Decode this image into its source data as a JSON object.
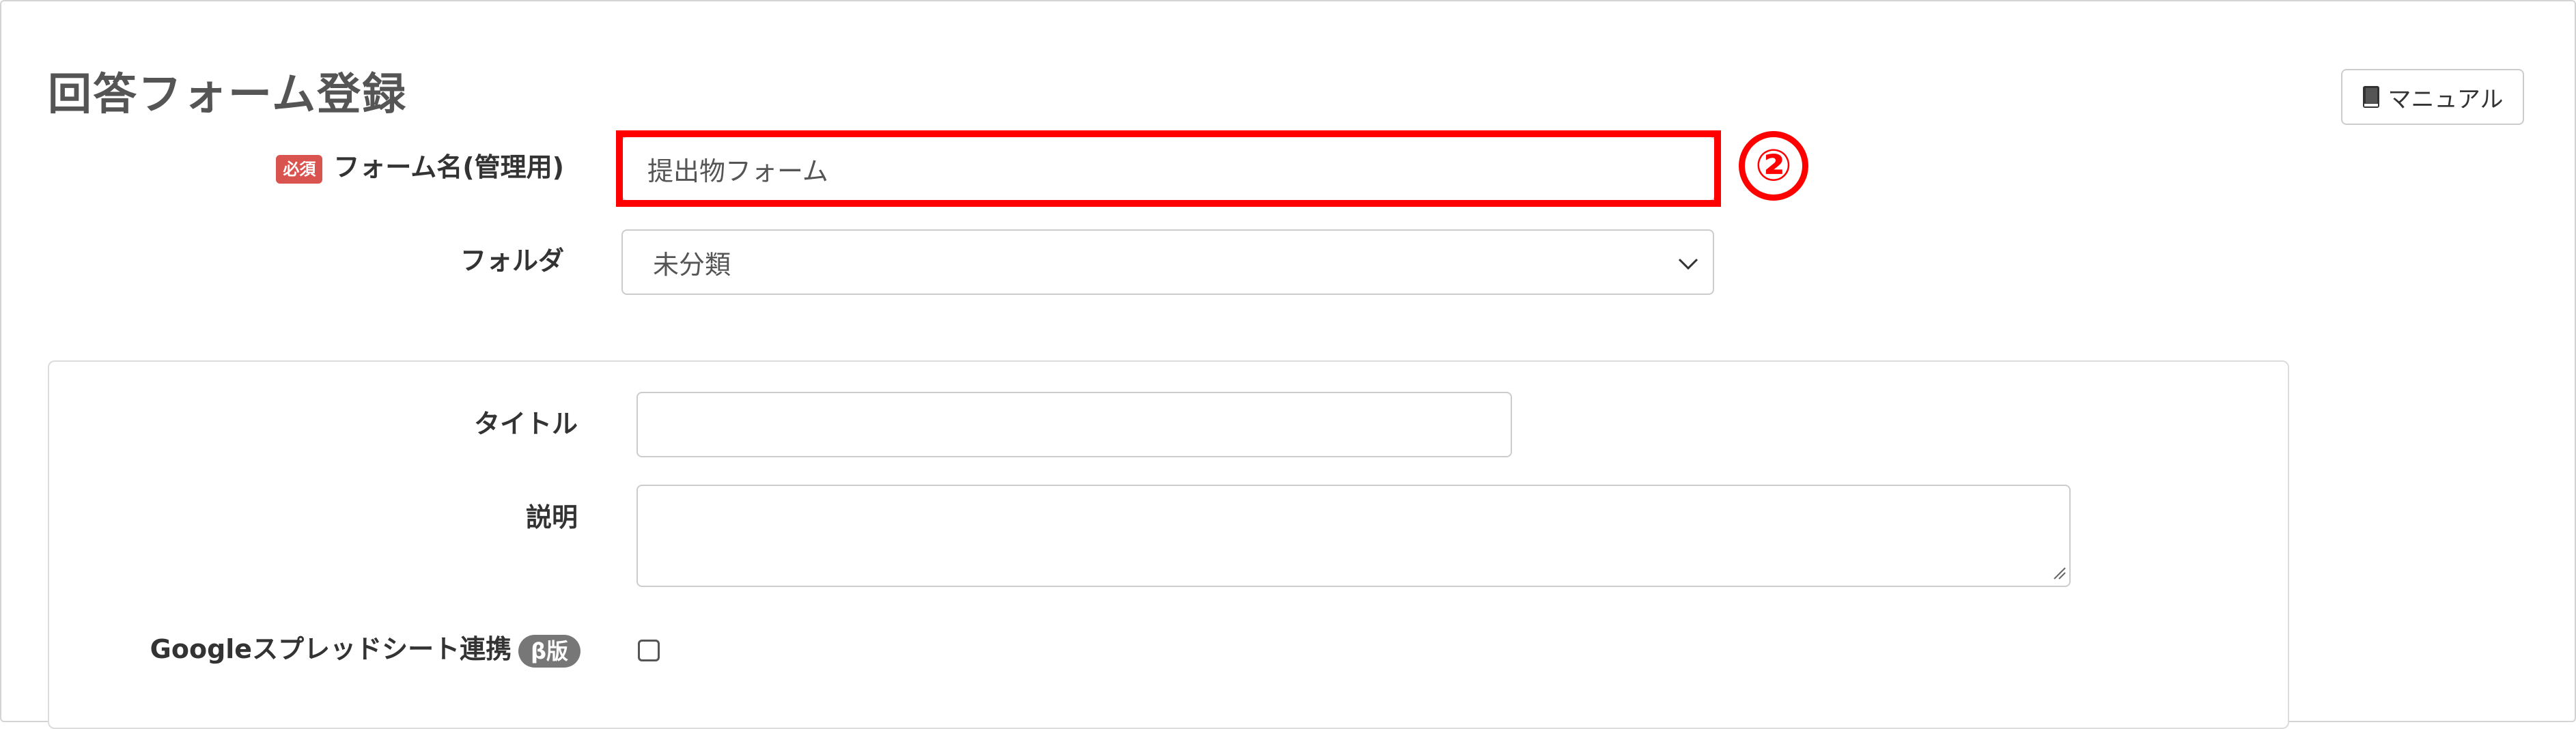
{
  "page": {
    "title": "回答フォーム登録",
    "manual_button_label": "マニュアル"
  },
  "form": {
    "name_field": {
      "required_badge": "必須",
      "label": "フォーム名(管理用)",
      "value": "提出物フォーム"
    },
    "folder_field": {
      "label": "フォルダ",
      "selected": "未分類"
    }
  },
  "annotation": {
    "step_marker": "②",
    "color": "#ff0000"
  },
  "panel": {
    "title_field": {
      "label": "タイトル",
      "value": ""
    },
    "description_field": {
      "label": "説明",
      "value": ""
    },
    "sheets_field": {
      "label": "Googleスプレッドシート連携",
      "beta_badge": "β版",
      "checked": false
    }
  },
  "colors": {
    "required_badge": "#d9534f",
    "beta_badge": "#777777",
    "title_text": "#555555"
  }
}
